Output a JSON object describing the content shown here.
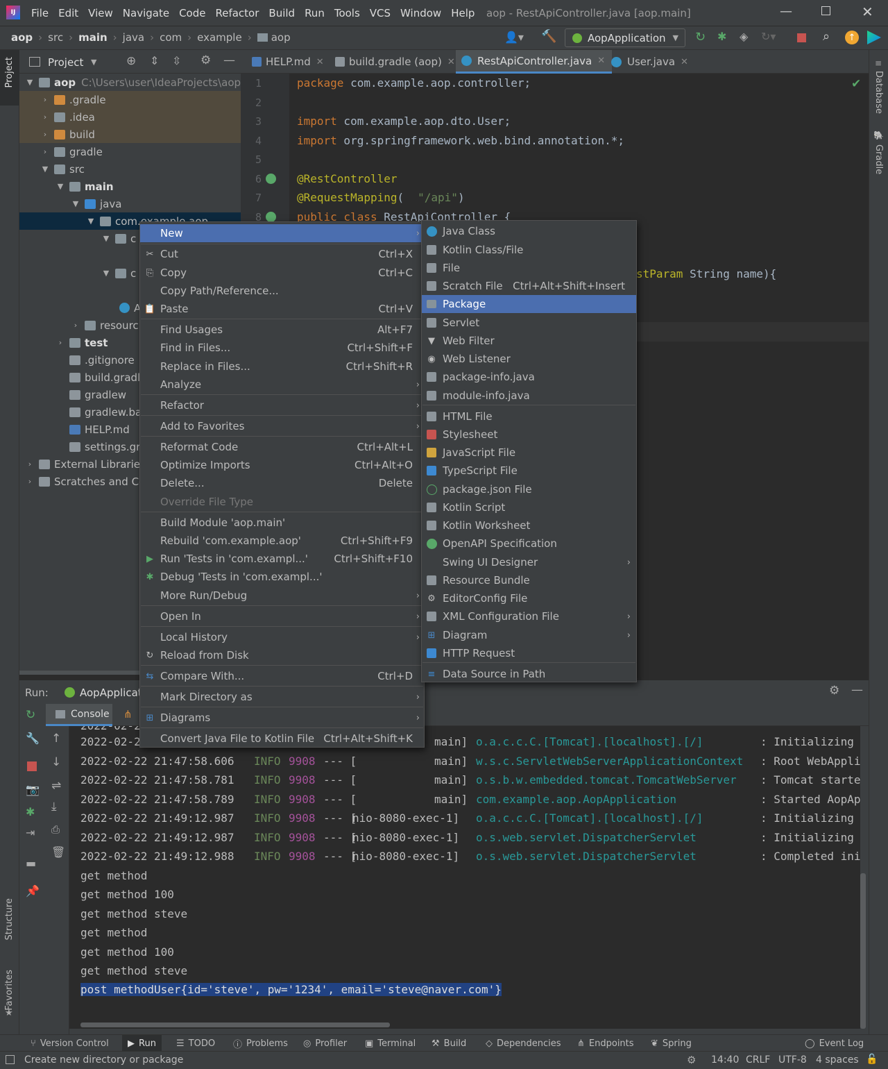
{
  "window": {
    "title": "aop - RestApiController.java [aop.main]"
  },
  "menubar": [
    "File",
    "Edit",
    "View",
    "Navigate",
    "Code",
    "Refactor",
    "Build",
    "Run",
    "Tools",
    "VCS",
    "Window",
    "Help"
  ],
  "breadcrumb": [
    "aop",
    "src",
    "main",
    "java",
    "com",
    "example",
    "aop"
  ],
  "run_config": "AopApplication",
  "project_panel": {
    "title": "Project",
    "tree": [
      {
        "label": "aop",
        "path": "C:\\Users\\user\\IdeaProjects\\aop"
      },
      {
        "label": ".gradle"
      },
      {
        "label": ".idea"
      },
      {
        "label": "build"
      },
      {
        "label": "gradle"
      },
      {
        "label": "src"
      },
      {
        "label": "main"
      },
      {
        "label": "java"
      },
      {
        "label": "com.example.aop"
      },
      {
        "label": "c"
      },
      {
        "label": "c"
      },
      {
        "label": "A"
      },
      {
        "label": "resourc"
      },
      {
        "label": "test"
      },
      {
        "label": ".gitignore"
      },
      {
        "label": "build.gradle"
      },
      {
        "label": "gradlew"
      },
      {
        "label": "gradlew.bat"
      },
      {
        "label": "HELP.md"
      },
      {
        "label": "settings.gradle"
      },
      {
        "label": "External Libraries"
      },
      {
        "label": "Scratches and Co"
      }
    ]
  },
  "editor_tabs": [
    "HELP.md",
    "build.gradle (aop)",
    "RestApiController.java",
    "User.java"
  ],
  "code": {
    "line_numbers": [
      "1",
      "2",
      "3",
      "4",
      "5",
      "6",
      "7",
      "8"
    ],
    "l1_kw": "package",
    "l1_rest": " com.example.aop.controller;",
    "l3_kw": "import",
    "l3_rest": " com.example.aop.dto.User;",
    "l4_kw": "import",
    "l4_rest": " org.springframework.web.bind.annotation.*;",
    "l6": "@RestController",
    "l7_an": "@RequestMapping",
    "l7_open": "(",
    "l7_str": "\"/api\"",
    "l7_close": ")",
    "l8_kw": "public class",
    "l8_rest": " RestApiController {",
    "frag_an": "stParam",
    "frag_rest": " String name){"
  },
  "context_menu": {
    "items": [
      {
        "label": "New",
        "shortcut": "",
        "submenu": true,
        "selected": true
      },
      {
        "label": "Cut",
        "shortcut": "Ctrl+X",
        "icon": "cut-icon"
      },
      {
        "label": "Copy",
        "shortcut": "Ctrl+C",
        "icon": "copy-icon"
      },
      {
        "label": "Copy Path/Reference...",
        "shortcut": ""
      },
      {
        "label": "Paste",
        "shortcut": "Ctrl+V",
        "icon": "paste-icon"
      },
      {
        "label": "Find Usages",
        "shortcut": "Alt+F7"
      },
      {
        "label": "Find in Files...",
        "shortcut": "Ctrl+Shift+F"
      },
      {
        "label": "Replace in Files...",
        "shortcut": "Ctrl+Shift+R"
      },
      {
        "label": "Analyze",
        "shortcut": "",
        "submenu": true
      },
      {
        "label": "Refactor",
        "shortcut": "",
        "submenu": true
      },
      {
        "label": "Add to Favorites",
        "shortcut": "",
        "submenu": true
      },
      {
        "label": "Reformat Code",
        "shortcut": "Ctrl+Alt+L"
      },
      {
        "label": "Optimize Imports",
        "shortcut": "Ctrl+Alt+O"
      },
      {
        "label": "Delete...",
        "shortcut": "Delete"
      },
      {
        "label": "Override File Type",
        "shortcut": "",
        "disabled": true
      },
      {
        "label": "Build Module 'aop.main'",
        "shortcut": ""
      },
      {
        "label": "Rebuild 'com.example.aop'",
        "shortcut": "Ctrl+Shift+F9"
      },
      {
        "label": "Run 'Tests in 'com.exampl...'",
        "shortcut": "Ctrl+Shift+F10",
        "icon": "run-icon"
      },
      {
        "label": "Debug 'Tests in 'com.exampl...'",
        "shortcut": "",
        "icon": "debug-icon"
      },
      {
        "label": "More Run/Debug",
        "shortcut": "",
        "submenu": true
      },
      {
        "label": "Open In",
        "shortcut": "",
        "submenu": true
      },
      {
        "label": "Local History",
        "shortcut": "",
        "submenu": true
      },
      {
        "label": "Reload from Disk",
        "shortcut": "",
        "icon": "reload-icon"
      },
      {
        "label": "Compare With...",
        "shortcut": "Ctrl+D",
        "icon": "compare-icon"
      },
      {
        "label": "Mark Directory as",
        "shortcut": "",
        "submenu": true
      },
      {
        "label": "Diagrams",
        "shortcut": "",
        "submenu": true,
        "icon": "diagram-icon"
      },
      {
        "label": "Convert Java File to Kotlin File",
        "shortcut": "Ctrl+Alt+Shift+K"
      }
    ]
  },
  "new_submenu": {
    "items": [
      {
        "label": "Java Class",
        "shortcut": ""
      },
      {
        "label": "Kotlin Class/File",
        "shortcut": ""
      },
      {
        "label": "File",
        "shortcut": ""
      },
      {
        "label": "Scratch File",
        "shortcut": "Ctrl+Alt+Shift+Insert"
      },
      {
        "label": "Package",
        "shortcut": "",
        "selected": true
      },
      {
        "label": "Servlet",
        "shortcut": ""
      },
      {
        "label": "Web Filter",
        "shortcut": ""
      },
      {
        "label": "Web Listener",
        "shortcut": ""
      },
      {
        "label": "package-info.java",
        "shortcut": ""
      },
      {
        "label": "module-info.java",
        "shortcut": ""
      },
      {
        "label": "HTML File",
        "shortcut": ""
      },
      {
        "label": "Stylesheet",
        "shortcut": ""
      },
      {
        "label": "JavaScript File",
        "shortcut": ""
      },
      {
        "label": "TypeScript File",
        "shortcut": ""
      },
      {
        "label": "package.json File",
        "shortcut": ""
      },
      {
        "label": "Kotlin Script",
        "shortcut": ""
      },
      {
        "label": "Kotlin Worksheet",
        "shortcut": ""
      },
      {
        "label": "OpenAPI Specification",
        "shortcut": ""
      },
      {
        "label": "Swing UI Designer",
        "shortcut": "",
        "submenu": true
      },
      {
        "label": "Resource Bundle",
        "shortcut": ""
      },
      {
        "label": "EditorConfig File",
        "shortcut": ""
      },
      {
        "label": "XML Configuration File",
        "shortcut": "",
        "submenu": true
      },
      {
        "label": "Diagram",
        "shortcut": "",
        "submenu": true
      },
      {
        "label": "HTTP Request",
        "shortcut": ""
      },
      {
        "label": "Data Source in Path",
        "shortcut": ""
      }
    ]
  },
  "run_panel": {
    "label": "Run:",
    "config": "AopApplicat",
    "console_tab": "Console",
    "log": [
      {
        "ts": "2022-02-2",
        "level": "",
        "pid": "",
        "sep": "",
        "thread": "",
        "logger": "",
        "msg": "",
        "partial": true
      },
      {
        "ts": "2022-02-2",
        "level": "",
        "pid": "",
        "sep": "",
        "thread": "main]",
        "logger": "o.a.c.c.C.[Tomcat].[localhost].[/]",
        "msg": ": Initializing S"
      },
      {
        "ts": "2022-02-22 21:47:58.606",
        "level": "INFO",
        "pid": "9908",
        "sep": "--- [",
        "thread": "main]",
        "logger": "w.s.c.ServletWebServerApplicationContext",
        "msg": ": Root WebApplic"
      },
      {
        "ts": "2022-02-22 21:47:58.781",
        "level": "INFO",
        "pid": "9908",
        "sep": "--- [",
        "thread": "main]",
        "logger": "o.s.b.w.embedded.tomcat.TomcatWebServer",
        "msg": ": Tomcat started"
      },
      {
        "ts": "2022-02-22 21:47:58.789",
        "level": "INFO",
        "pid": "9908",
        "sep": "--- [",
        "thread": "main]",
        "logger": "com.example.aop.AopApplication",
        "msg": ": Started AopApp"
      },
      {
        "ts": "2022-02-22 21:49:12.987",
        "level": "INFO",
        "pid": "9908",
        "sep": "--- [",
        "thread": "nio-8080-exec-1]",
        "logger": "o.a.c.c.C.[Tomcat].[localhost].[/]",
        "msg": ": Initializing S"
      },
      {
        "ts": "2022-02-22 21:49:12.987",
        "level": "INFO",
        "pid": "9908",
        "sep": "--- [",
        "thread": "nio-8080-exec-1]",
        "logger": "o.s.web.servlet.DispatcherServlet",
        "msg": ": Initializing S"
      },
      {
        "ts": "2022-02-22 21:49:12.988",
        "level": "INFO",
        "pid": "9908",
        "sep": "--- [",
        "thread": "nio-8080-exec-1]",
        "logger": "o.s.web.servlet.DispatcherServlet",
        "msg": ": Completed init"
      }
    ],
    "output": [
      "get method",
      "get method 100",
      "get method steve",
      "get method",
      "get method 100",
      "get method steve"
    ],
    "selected_line": "post methodUser{id='steve', pw='1234', email='steve@naver.com'}"
  },
  "bottom_tools": [
    "Version Control",
    "Run",
    "TODO",
    "Problems",
    "Profiler",
    "Terminal",
    "Build",
    "Dependencies",
    "Endpoints",
    "Spring",
    "Event Log"
  ],
  "left_strip": [
    "Project",
    "Structure",
    "Favorites"
  ],
  "right_strip": [
    "Database",
    "Gradle"
  ],
  "statusbar": {
    "message": "Create new directory or package",
    "time": "14:40",
    "line_sep": "CRLF",
    "encoding": "UTF-8",
    "indent": "4 spaces"
  }
}
